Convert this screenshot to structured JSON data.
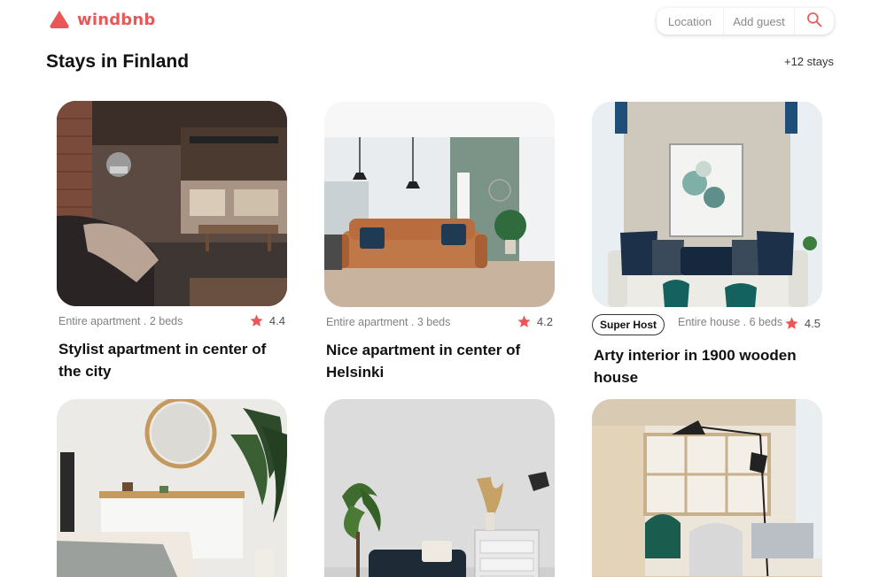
{
  "app": {
    "name": "windbnb",
    "brand_color": "#eb5757",
    "logo_icon": "logo-mark-icon"
  },
  "search": {
    "location_label": "Location",
    "guests_label": "Add guest",
    "icon": "search-icon"
  },
  "section": {
    "title": "Stays in Finland",
    "count": "+12 stays"
  },
  "stays": [
    {
      "type": "Entire apartment . 2 beds",
      "rating": "4.4",
      "title": "Stylist apartment in center of the city",
      "super_host": false,
      "photo_icon": "loft-interior-photo"
    },
    {
      "type": "Entire apartment . 3 beds",
      "rating": "4.2",
      "title": "Nice apartment in center of Helsinki",
      "super_host": false,
      "photo_icon": "living-room-sofa-photo"
    },
    {
      "type": "Entire house . 6 beds",
      "rating": "4.5",
      "title": "Arty interior in 1900 wooden house",
      "super_host": true,
      "badge": "Super Host",
      "photo_icon": "arty-sofa-photo"
    },
    {
      "photo_icon": "bedroom-mirror-photo"
    },
    {
      "photo_icon": "grey-room-chair-photo"
    },
    {
      "photo_icon": "wooden-room-lamp-photo"
    }
  ],
  "icons": {
    "star": "star-icon"
  }
}
